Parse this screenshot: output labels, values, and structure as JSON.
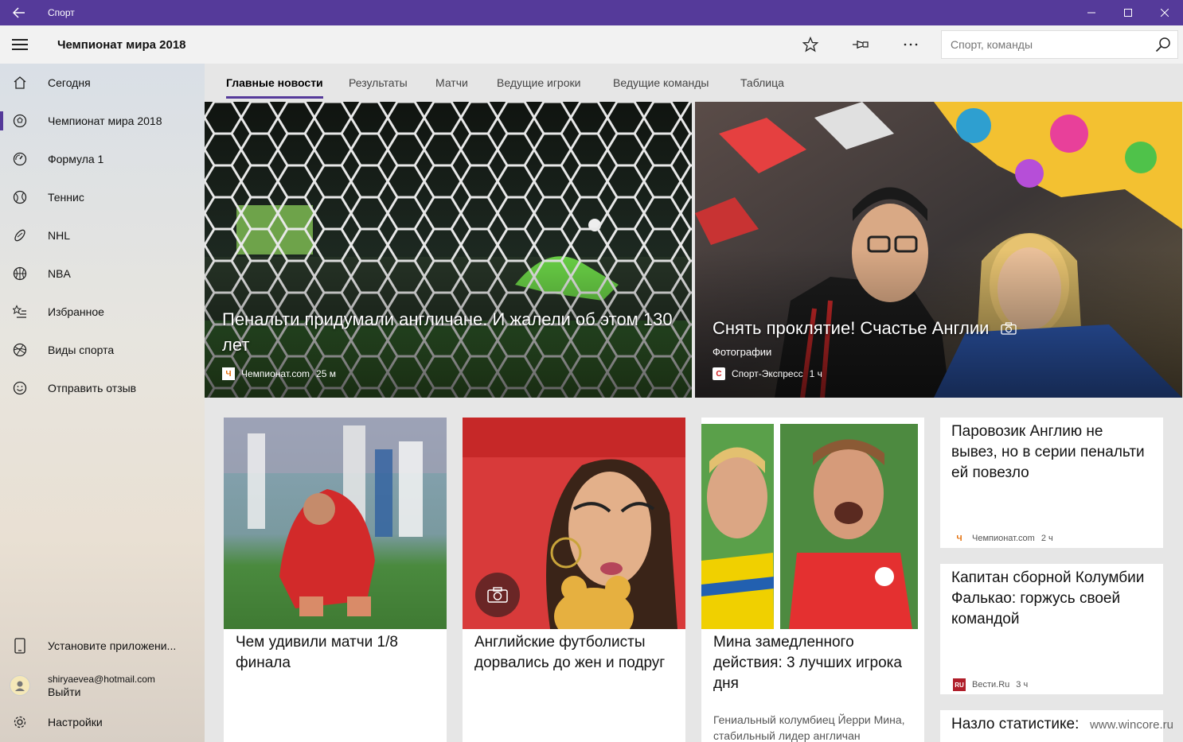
{
  "window": {
    "app_title": "Спорт",
    "controls": {
      "minimize": "—",
      "maximize": "☐",
      "close": "✕"
    }
  },
  "appbar": {
    "page_title": "Чемпионат мира 2018",
    "search_placeholder": "Спорт, команды"
  },
  "sidebar": {
    "items": [
      {
        "label": "Сегодня",
        "icon": "home-icon"
      },
      {
        "label": "Чемпионат мира 2018",
        "icon": "soccer-ball-icon",
        "active": true
      },
      {
        "label": "Формула 1",
        "icon": "speedometer-icon"
      },
      {
        "label": "Теннис",
        "icon": "tennis-ball-icon"
      },
      {
        "label": "NHL",
        "icon": "hockey-puck-icon"
      },
      {
        "label": "NBA",
        "icon": "basketball-icon"
      },
      {
        "label": "Избранное",
        "icon": "favorites-list-icon"
      },
      {
        "label": "Виды спорта",
        "icon": "sports-icon"
      },
      {
        "label": "Отправить отзыв",
        "icon": "smiley-icon"
      }
    ],
    "install_label": "Установите приложени...",
    "account_email": "shiryaevea@hotmail.com",
    "logout_label": "Выйти",
    "settings_label": "Настройки"
  },
  "tabs": [
    "Главные новости",
    "Результаты",
    "Матчи",
    "Ведущие игроки",
    "Ведущие команды",
    "Таблица"
  ],
  "hero": [
    {
      "headline": "Пенальти придумали англичане. И жалели об этом 130 лет",
      "source": "Чемпионат.com",
      "time": "25 м"
    },
    {
      "headline": "Снять проклятие! Счастье Англии",
      "category": "Фотографии",
      "source": "Спорт-Экспресс",
      "time": "1 ч"
    }
  ],
  "cards": [
    {
      "headline": "Чем удивили матчи 1/8 финала"
    },
    {
      "headline": "Английские футболисты дорвались до жен и подруг"
    },
    {
      "headline": "Мина замедленного действия: 3 лучших игрока дня",
      "snippet": "Гениальный колумбиец Йерри Мина, стабильный лидер англичан"
    }
  ],
  "side_cards": [
    {
      "headline": "Паровозик Англию не вывез, но в серии пенальти ей повезло",
      "source": "Чемпионат.com",
      "time": "2 ч"
    },
    {
      "headline": "Капитан сборной Колумбии Фалькао: горжусь своей командой",
      "source": "Вести.Ru",
      "time": "3 ч"
    },
    {
      "headline": "Назло статистике:"
    }
  ],
  "watermark": "www.wincore.ru",
  "colors": {
    "accent": "#553a9a"
  }
}
